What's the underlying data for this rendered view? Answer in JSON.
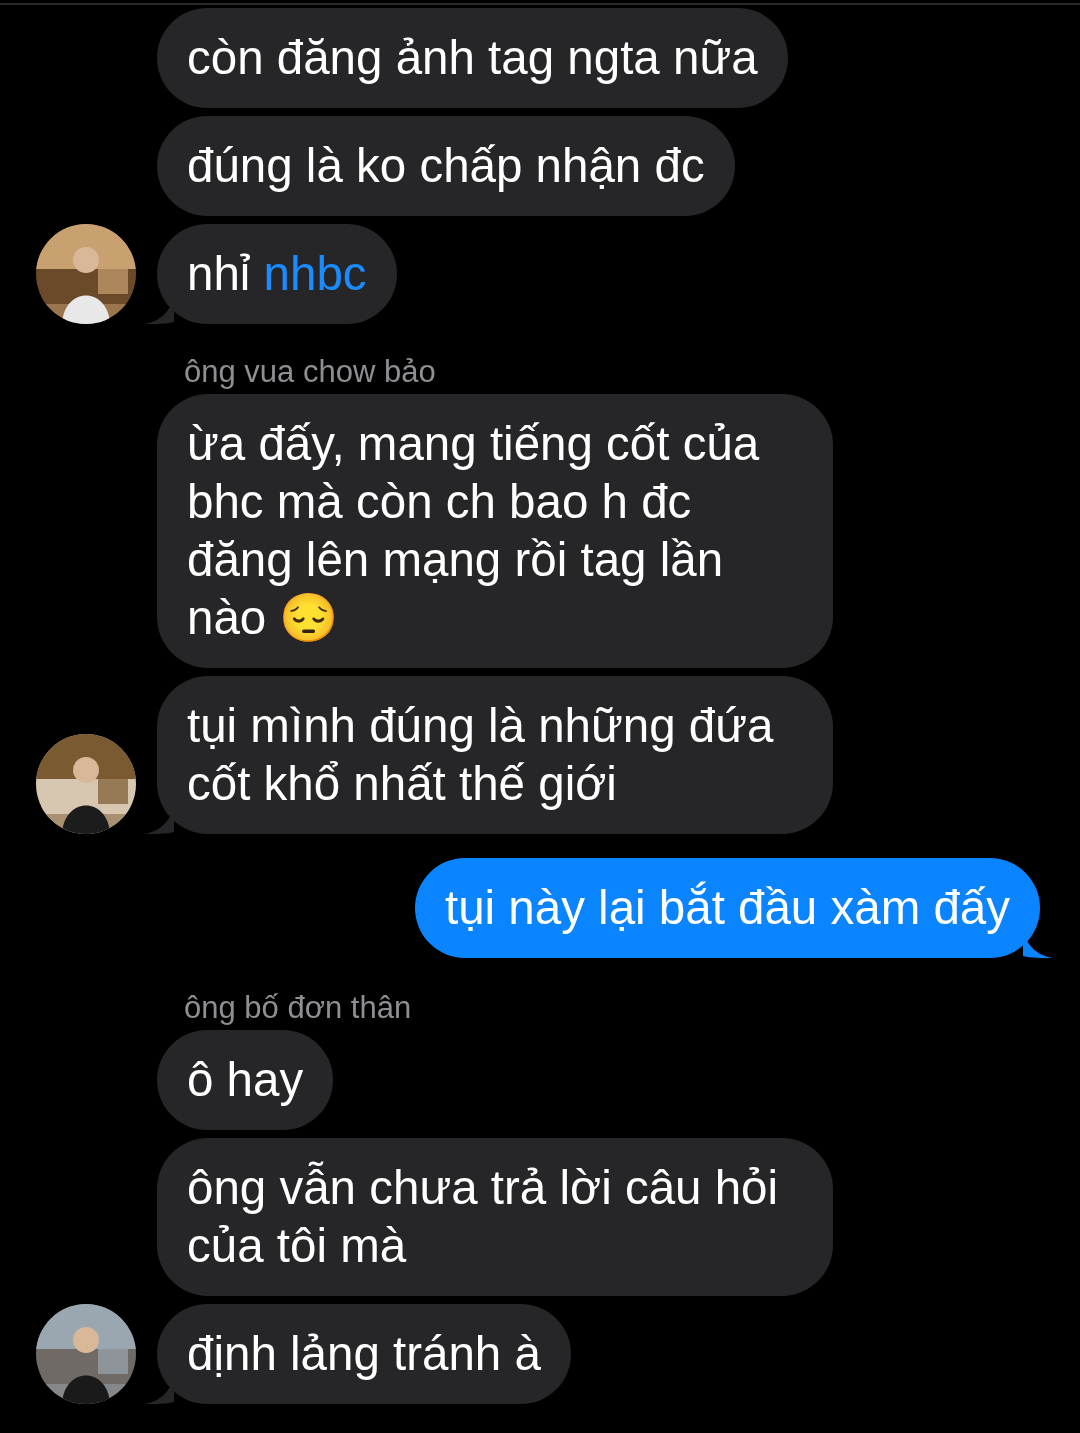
{
  "messages": [
    {
      "kind": "incoming",
      "text": "còn đăng ảnh tag ngta nữa",
      "tail": false,
      "avatar": false
    },
    {
      "kind": "incoming",
      "text": "đúng là ko chấp nhận đc",
      "tail": false,
      "avatar": false
    },
    {
      "kind": "incoming",
      "text": "nhỉ",
      "mention": "nhbc",
      "tail": true,
      "avatar": true
    },
    {
      "kind": "sender",
      "text": "ông vua chow bảo"
    },
    {
      "kind": "incoming",
      "text": "ừa đấy, mang tiếng cốt của bhc mà còn ch bao h đc đăng lên mạng rồi tag lần nào 😔",
      "tail": false,
      "avatar": false
    },
    {
      "kind": "incoming",
      "text": "tụi mình đúng là những đứa cốt khổ nhất thế giới",
      "tail": true,
      "avatar": true
    },
    {
      "kind": "outgoing",
      "text": "tụi này lại bắt đầu xàm đấy",
      "tail": true
    },
    {
      "kind": "sender",
      "text": "ông bố đơn thân"
    },
    {
      "kind": "incoming",
      "text": "ô hay",
      "tail": false,
      "avatar": false
    },
    {
      "kind": "incoming",
      "text": "ông vẫn chưa trả lời câu hỏi của tôi mà",
      "tail": false,
      "avatar": false
    },
    {
      "kind": "incoming",
      "text": "định lảng tránh à",
      "tail": true,
      "avatar": true
    }
  ]
}
